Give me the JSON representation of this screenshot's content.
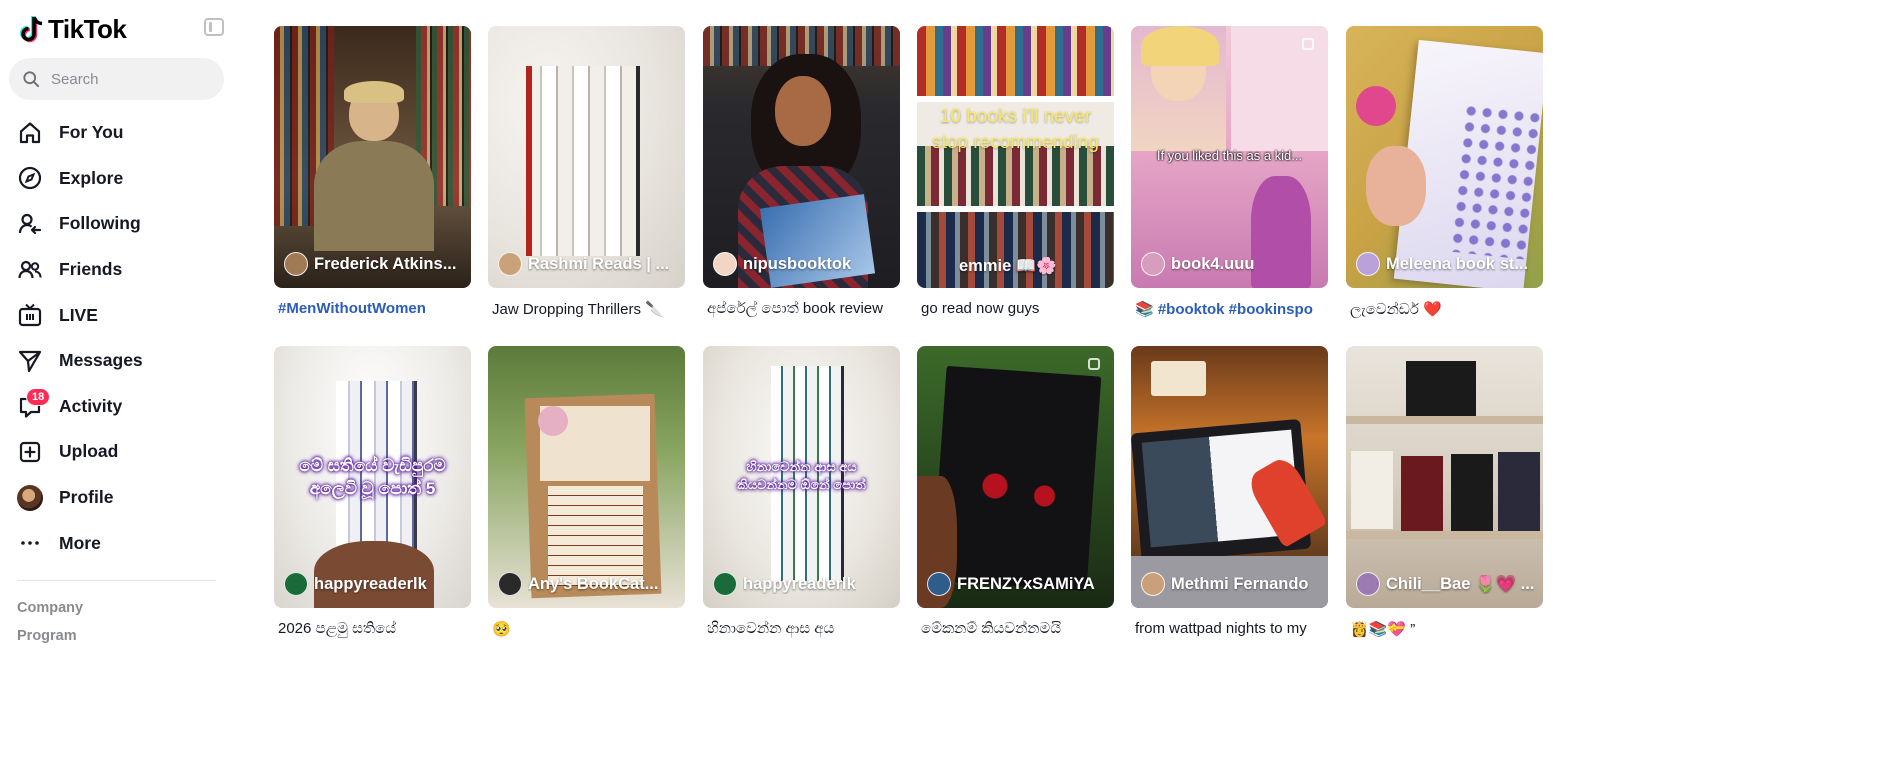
{
  "app": {
    "name": "TikTok"
  },
  "search": {
    "placeholder": "Search"
  },
  "nav": {
    "items": [
      {
        "label": "For You",
        "icon": "home-icon"
      },
      {
        "label": "Explore",
        "icon": "compass-icon"
      },
      {
        "label": "Following",
        "icon": "following-icon"
      },
      {
        "label": "Friends",
        "icon": "friends-icon"
      },
      {
        "label": "LIVE",
        "icon": "live-tv-icon"
      },
      {
        "label": "Messages",
        "icon": "paper-plane-icon"
      },
      {
        "label": "Activity",
        "icon": "activity-icon",
        "badge": "18"
      },
      {
        "label": "Upload",
        "icon": "plus-square-icon"
      },
      {
        "label": "Profile",
        "icon": "avatar"
      },
      {
        "label": "More",
        "icon": "more-dots-icon"
      }
    ]
  },
  "footer": {
    "company": "Company",
    "program": "Program"
  },
  "colors": {
    "accent": "#fe2c55",
    "hashtag": "#2b5db9",
    "text": "#161823",
    "muted": "#8a8b91"
  },
  "videos": [
    {
      "author": "Frederick Atkins...",
      "caption": "#MenWithoutWomen"
    },
    {
      "author": "Rashmi Reads | ...",
      "caption": "Jaw Dropping Thrillers 🔪"
    },
    {
      "author": "nipusbooktok",
      "caption": "අප්රේල් පොත් book review"
    },
    {
      "author": "emmie 📖🌸",
      "caption": "go read now guys",
      "overlay": "10 books i'll never stop recommending"
    },
    {
      "author": "book4.uuu",
      "caption": "📚 #booktok #bookinspo",
      "overlay": "If you liked this as a kid..."
    },
    {
      "author": "Meleena book st...",
      "caption": "ලැවෙන්ඩර් ❤️"
    },
    {
      "author": "happyreaderlk",
      "caption": "2026 පළමු සතියේ",
      "overlay": "මේ සතියේ වැඩිපුරම අලෙවි වූ පොත් 5"
    },
    {
      "author": "Any's BookCat...",
      "caption": "🥺"
    },
    {
      "author": "happyreaderlk",
      "caption": "හිනාවෙන්න ආස අය",
      "overlay": "හිනාවෙන්න ආස අය කියවන්නම ඕනේ පොත්"
    },
    {
      "author": "FRENZYxSAMiYA",
      "caption": "මේකනම් කියවන්නමයි"
    },
    {
      "author": "Methmi Fernando",
      "caption": "from wattpad nights to my"
    },
    {
      "author": "Chili__Bae 🌷💗 ...",
      "caption": "👸📚💝 ”"
    }
  ]
}
